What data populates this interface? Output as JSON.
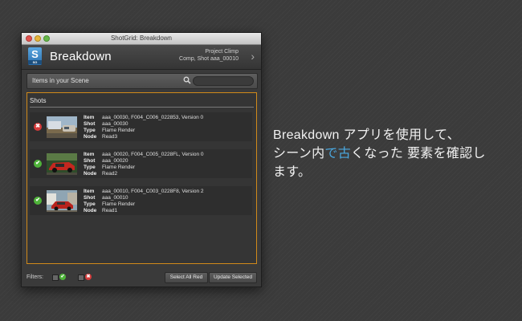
{
  "window": {
    "title": "ShotGrid: Breakdown"
  },
  "header": {
    "app_title": "Breakdown",
    "logo_letter": "S",
    "logo_sub": "SG",
    "project": "Project Climp",
    "context": "Comp, Shot aaa_00010"
  },
  "search": {
    "section_label": "Items in your Scene",
    "placeholder": ""
  },
  "shots": {
    "title": "Shots",
    "rows": [
      {
        "status": "out-of-date",
        "item": "aaa_00030, F004_C006_022853, Version 0",
        "shot": "aaa_00030",
        "type": "Flame Render",
        "node": "Read3"
      },
      {
        "status": "up-to-date",
        "item": "aaa_00020, F004_C005_0228FL, Version 0",
        "shot": "aaa_00020",
        "type": "Flame Render",
        "node": "Read2"
      },
      {
        "status": "up-to-date",
        "item": "aaa_00010, F004_C003_0228F8, Version 2",
        "shot": "aaa_00010",
        "type": "Flame Render",
        "node": "Read1"
      }
    ],
    "keys": {
      "item": "Item",
      "shot": "Shot",
      "type": "Type",
      "node": "Node"
    }
  },
  "footer": {
    "filters_label": "Filters:",
    "select_all_red": "Select All Red",
    "update_selected": "Update Selected"
  },
  "caption": {
    "line1": "Breakdown アプリを使用して、",
    "line2_a": "シーン内",
    "line2_b": "で古",
    "line2_c": "くなった 要素を確認し",
    "line3": "ます。"
  },
  "colors": {
    "highlight_border": "#d18a1a",
    "ok": "#4fb33a",
    "bad": "#d63b3b",
    "caption_highlight": "#4aa8e0"
  }
}
